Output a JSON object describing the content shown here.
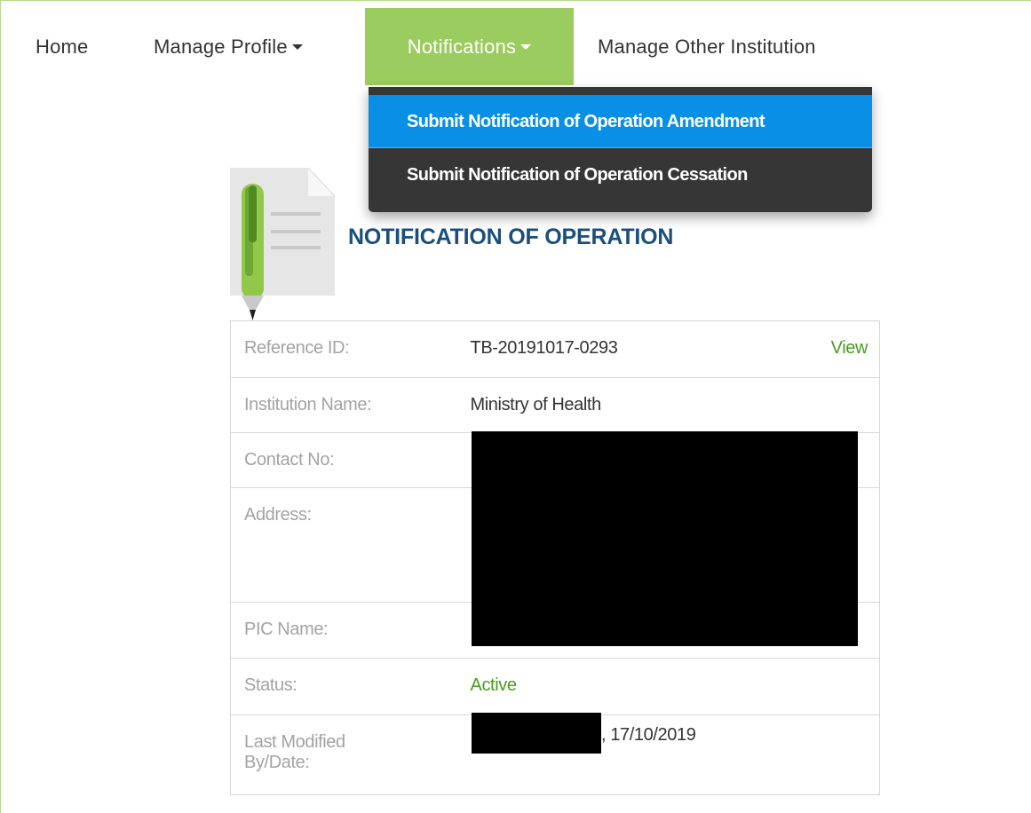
{
  "nav": {
    "home": "Home",
    "manage_profile": "Manage Profile",
    "notifications": "Notifications",
    "manage_other": "Manage Other Institution"
  },
  "dropdown": {
    "items": [
      "Submit Notification of Operation Amendment",
      "Submit Notification of Operation Cessation"
    ]
  },
  "page": {
    "title": "NOTIFICATION OF OPERATION"
  },
  "info": {
    "reference_label": "Reference ID:",
    "reference_value": "TB-20191017-0293",
    "view_link": "View",
    "institution_label": "Institution Name:",
    "institution_value": "Ministry of Health",
    "contact_label": "Contact No:",
    "address_label": "Address:",
    "pic_label": "PIC Name:",
    "status_label": "Status:",
    "status_value": "Active",
    "modified_label_1": "Last Modified",
    "modified_label_2": "By/Date:",
    "modified_date": ", 17/10/2019"
  },
  "colors": {
    "nav_active_bg": "#9bcc5f",
    "dropdown_bg": "#363636",
    "dropdown_active_bg": "#0a8fe6",
    "title": "#1a4f7d",
    "status_green": "#4a9b1f"
  },
  "icons": {
    "caret": "caret-down-icon",
    "document": "document-pen-icon"
  }
}
